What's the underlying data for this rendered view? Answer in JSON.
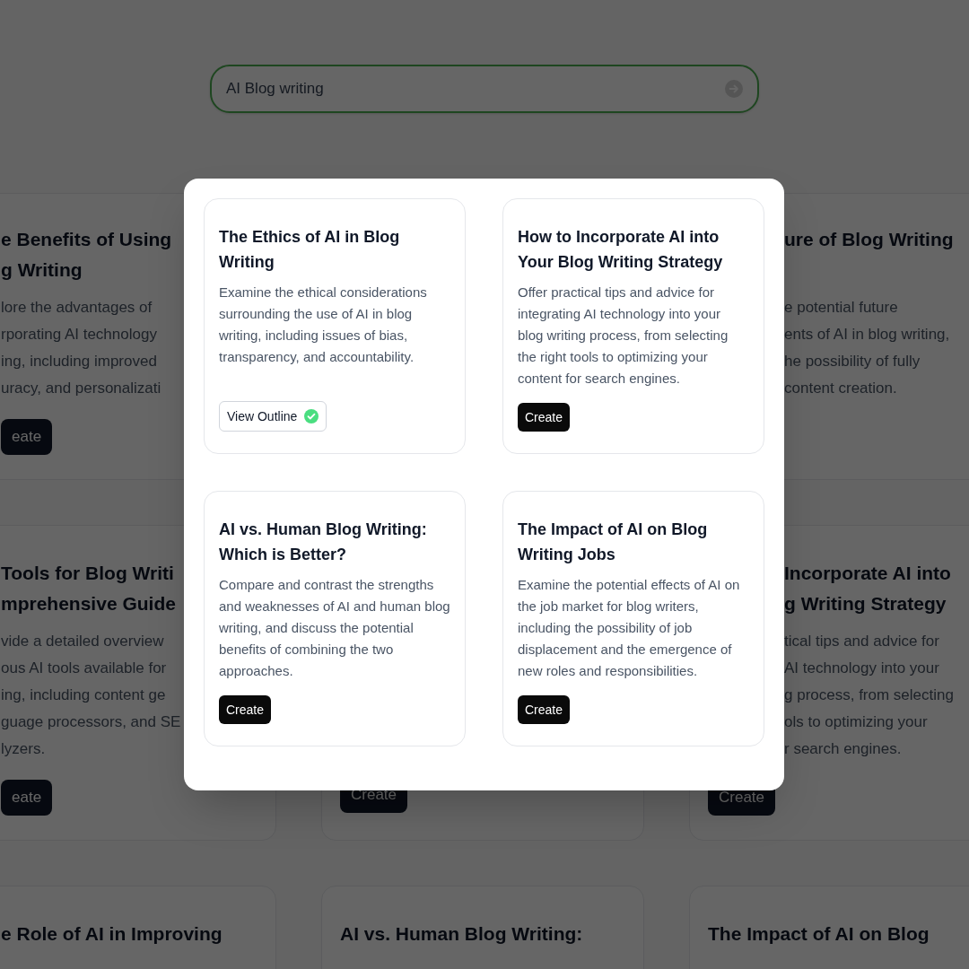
{
  "search": {
    "value": "AI Blog writing"
  },
  "background_columns": [
    {
      "cards": [
        {
          "title_lines": [
            "e Benefits of Using",
            "g Writing"
          ],
          "description_lines": [
            "lore the advantages of",
            "rporating AI technology",
            "ing, including improved",
            "uracy, and personalizati"
          ],
          "button": "eate"
        },
        {
          "title_lines": [
            "Tools for Blog Writi",
            "mprehensive Guide"
          ],
          "description_lines": [
            "vide a detailed overview",
            "ous AI tools available for",
            "ing, including content ge",
            "guage processors, and SE",
            "lyzers."
          ],
          "button": "eate"
        },
        {
          "title_lines": [
            "e Role of AI in Improving"
          ]
        }
      ]
    },
    {
      "cards": [
        {
          "button": "Create"
        },
        {
          "title_lines": [
            "AI vs. Human Blog Writing:"
          ]
        }
      ]
    },
    {
      "cards": [
        {
          "title_lines": [
            "ure of Blog Writing"
          ],
          "description_lines": [
            "e potential future",
            "ents of AI in blog writing,",
            "he possibility of fully",
            "content creation."
          ]
        },
        {
          "title_lines": [
            "Incorporate AI into",
            "g Writing Strategy"
          ],
          "description_lines": [
            "tical tips and advice for",
            "AI technology into your",
            "g process, from selecting",
            "ols to optimizing your",
            "r search engines."
          ],
          "button": "Create"
        },
        {
          "title_lines": [
            "The Impact of AI on Blog"
          ]
        }
      ]
    }
  ],
  "modal": {
    "cards": [
      {
        "title": "The Ethics of AI in Blog Writing",
        "description": "Examine the ethical considerations surrounding the use of AI in blog writing, including issues of bias, transparency, and accountability.",
        "action": {
          "kind": "outline",
          "label": "View Outline",
          "done": true
        }
      },
      {
        "title": "How to Incorporate AI into Your Blog Writing Strategy",
        "description": "Offer practical tips and advice for integrating AI technology into your blog writing process, from selecting the right tools to optimizing your content for search engines.",
        "action": {
          "kind": "create",
          "label": "Create"
        }
      },
      {
        "title": "AI vs. Human Blog Writing: Which is Better?",
        "description": "Compare and contrast the strengths and weaknesses of AI and human blog writing, and discuss the potential benefits of combining the two approaches.",
        "action": {
          "kind": "create",
          "label": "Create"
        }
      },
      {
        "title": "The Impact of AI on Blog Writing Jobs",
        "description": "Examine the potential effects of AI on the job market for blog writers, including the possibility of job displacement and the emergence of new roles and responsibilities.",
        "action": {
          "kind": "create",
          "label": "Create"
        }
      }
    ]
  }
}
